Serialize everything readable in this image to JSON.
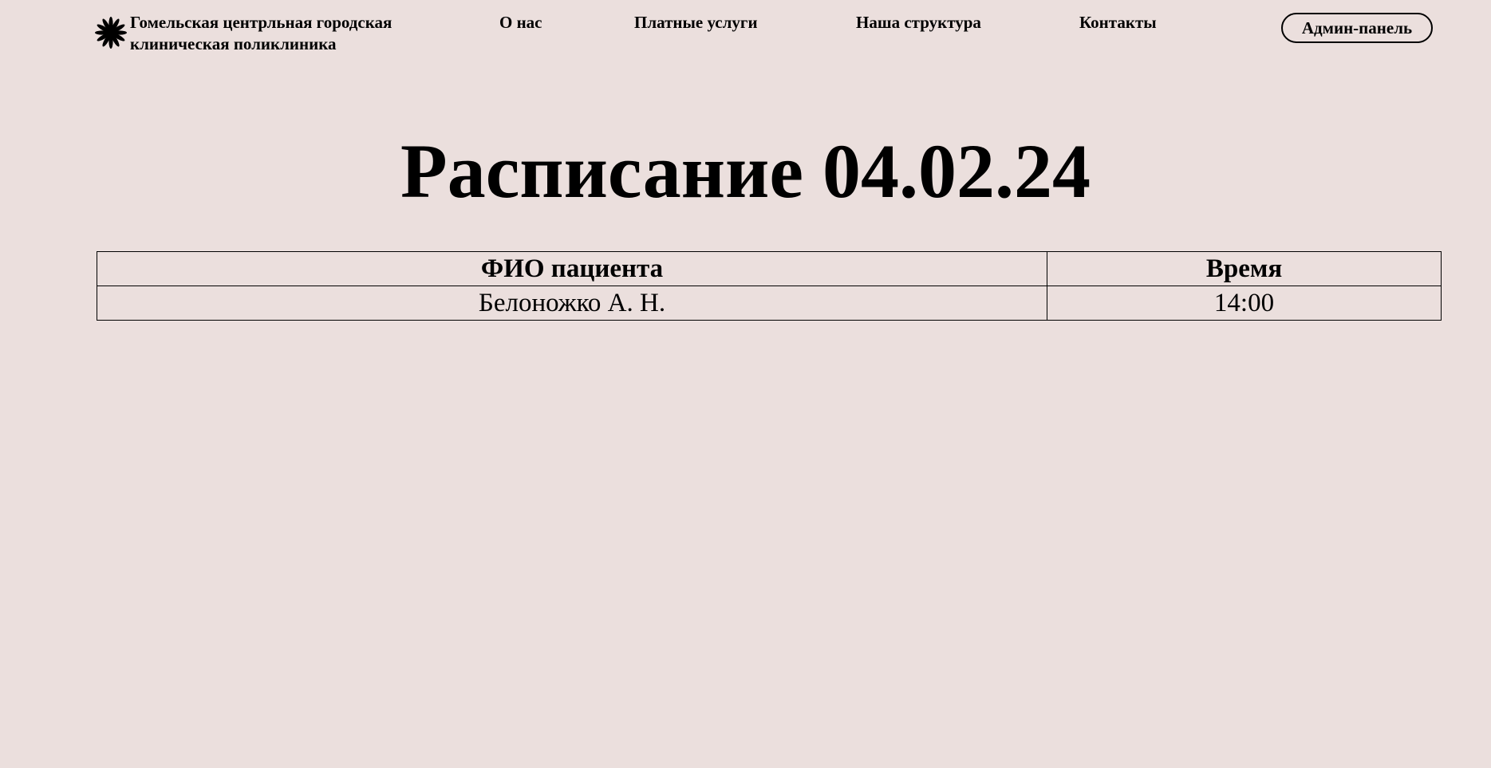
{
  "header": {
    "logo_icon": "flower-icon",
    "brand": "Гомельская центрльная городская\nклиническая поликлиника",
    "nav": [
      {
        "label": "О нас"
      },
      {
        "label": "Платные услуги"
      },
      {
        "label": "Наша структура"
      },
      {
        "label": "Контакты"
      }
    ],
    "admin_button": "Админ-панель"
  },
  "main": {
    "title": "Расписание 04.02.24",
    "table": {
      "columns": [
        "ФИО пациента",
        "Время"
      ],
      "rows": [
        [
          "Белоножко А. Н.",
          "14:00"
        ]
      ]
    }
  },
  "colors": {
    "background": "#ebdfdd",
    "text": "#000000"
  }
}
